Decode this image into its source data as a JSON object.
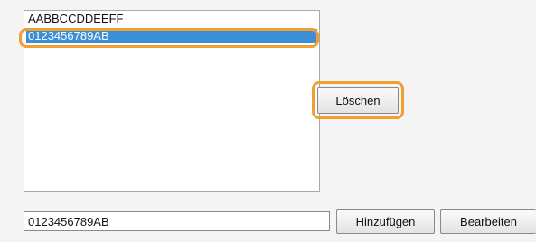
{
  "list": {
    "items": [
      {
        "label": "AABBCCDDEEFF",
        "selected": false
      },
      {
        "label": "0123456789AB",
        "selected": true
      }
    ],
    "selection_color": "#3a8fd8"
  },
  "buttons": {
    "delete_label": "Löschen",
    "add_label": "Hinzufügen",
    "edit_label": "Bearbeiten"
  },
  "input": {
    "value": "0123456789AB"
  },
  "highlight_color": "#f0a030"
}
